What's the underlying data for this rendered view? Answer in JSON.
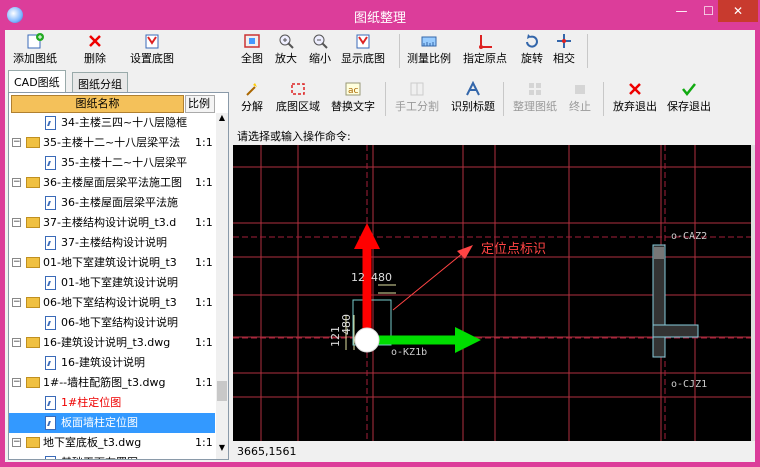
{
  "window": {
    "title": "图纸整理",
    "minimize": "—",
    "maximize": "☐",
    "close": "✕"
  },
  "left_toolbar": {
    "add_label": "添加图纸",
    "delete_label": "删除",
    "set_base_label": "设置底图"
  },
  "tabs": [
    "CAD图纸",
    "图纸分组"
  ],
  "tree": {
    "header_name": "图纸名称",
    "header_scale": "比例",
    "rows": [
      {
        "text": "34-主楼三四~十八层隐框",
        "scale": "",
        "type": "file"
      },
      {
        "text": "35-主楼十二~十八层梁平法",
        "scale": "1:1",
        "type": "folder",
        "expanded": "−"
      },
      {
        "text": "35-主楼十二~十八层梁平",
        "scale": "",
        "type": "file"
      },
      {
        "text": "36-主楼屋面层梁平法施工图",
        "scale": "1:1",
        "type": "folder",
        "expanded": "−"
      },
      {
        "text": "36-主楼屋面层梁平法施",
        "scale": "",
        "type": "file"
      },
      {
        "text": "37-主楼结构设计说明_t3.d",
        "scale": "1:1",
        "type": "folder",
        "expanded": "−"
      },
      {
        "text": "37-主楼结构设计说明",
        "scale": "",
        "type": "file"
      },
      {
        "text": "01-地下室建筑设计说明_t3",
        "scale": "1:1",
        "type": "folder",
        "expanded": "−"
      },
      {
        "text": "01-地下室建筑设计说明",
        "scale": "",
        "type": "file"
      },
      {
        "text": "06-地下室结构设计说明_t3",
        "scale": "1:1",
        "type": "folder",
        "expanded": "−"
      },
      {
        "text": "06-地下室结构设计说明",
        "scale": "",
        "type": "file"
      },
      {
        "text": "16-建筑设计说明_t3.dwg",
        "scale": "1:1",
        "type": "folder",
        "expanded": "−"
      },
      {
        "text": "16-建筑设计说明",
        "scale": "",
        "type": "file"
      },
      {
        "text": "1#--墙柱配筋图_t3.dwg",
        "scale": "1:1",
        "type": "folder",
        "expanded": "−"
      },
      {
        "text": "1#柱定位图",
        "scale": "",
        "type": "file",
        "red": true
      },
      {
        "text": "板面墙柱定位图",
        "scale": "",
        "type": "file",
        "selected": true
      },
      {
        "text": "地下室底板_t3.dwg",
        "scale": "1:1",
        "type": "folder",
        "expanded": "−"
      },
      {
        "text": "基础平面布置图",
        "scale": "",
        "type": "file"
      }
    ]
  },
  "toolbar1": [
    {
      "label": "全图",
      "icon": "full-view-icon"
    },
    {
      "label": "放大",
      "icon": "zoom-in-icon"
    },
    {
      "label": "缩小",
      "icon": "zoom-out-icon"
    },
    {
      "label": "显示底图",
      "icon": "show-base-icon"
    },
    {
      "label": "测量比例",
      "icon": "measure-scale-icon"
    },
    {
      "label": "指定原点",
      "icon": "set-origin-icon"
    },
    {
      "label": "旋转",
      "icon": "rotate-icon"
    },
    {
      "label": "相交",
      "icon": "intersect-icon"
    }
  ],
  "toolbar2": [
    {
      "label": "分解",
      "icon": "explode-icon",
      "enabled": true
    },
    {
      "label": "底图区域",
      "icon": "base-region-icon",
      "enabled": true
    },
    {
      "label": "替换文字",
      "icon": "replace-text-icon",
      "enabled": true
    },
    {
      "label": "手工分割",
      "icon": "manual-split-icon",
      "enabled": false
    },
    {
      "label": "识别标题",
      "icon": "recognize-title-icon",
      "enabled": true
    },
    {
      "label": "整理图纸",
      "icon": "organize-drawings-icon",
      "enabled": false
    },
    {
      "label": "终止",
      "icon": "stop-icon",
      "enabled": false
    },
    {
      "label": "放弃退出",
      "icon": "discard-exit-icon",
      "enabled": true
    },
    {
      "label": "保存退出",
      "icon": "save-exit-icon",
      "enabled": true
    }
  ],
  "command_prompt": "请选择或输入操作命令:",
  "canvas": {
    "locator_label": "定位点标识",
    "kz_label": "o-KZ1b",
    "caz_label": "o-CAZ2",
    "cjz_label": "o-CJZ1",
    "dim_top_a": "12",
    "dim_top_b": "480",
    "dim_side_a": "121",
    "dim_side_b": "480",
    "colors": {
      "red_arrow": "#ff0000",
      "green_arrow": "#00dd00",
      "grid_line": "#b0303f",
      "annotation": "#ff4444"
    }
  },
  "status": {
    "coords": "3665,1561"
  }
}
